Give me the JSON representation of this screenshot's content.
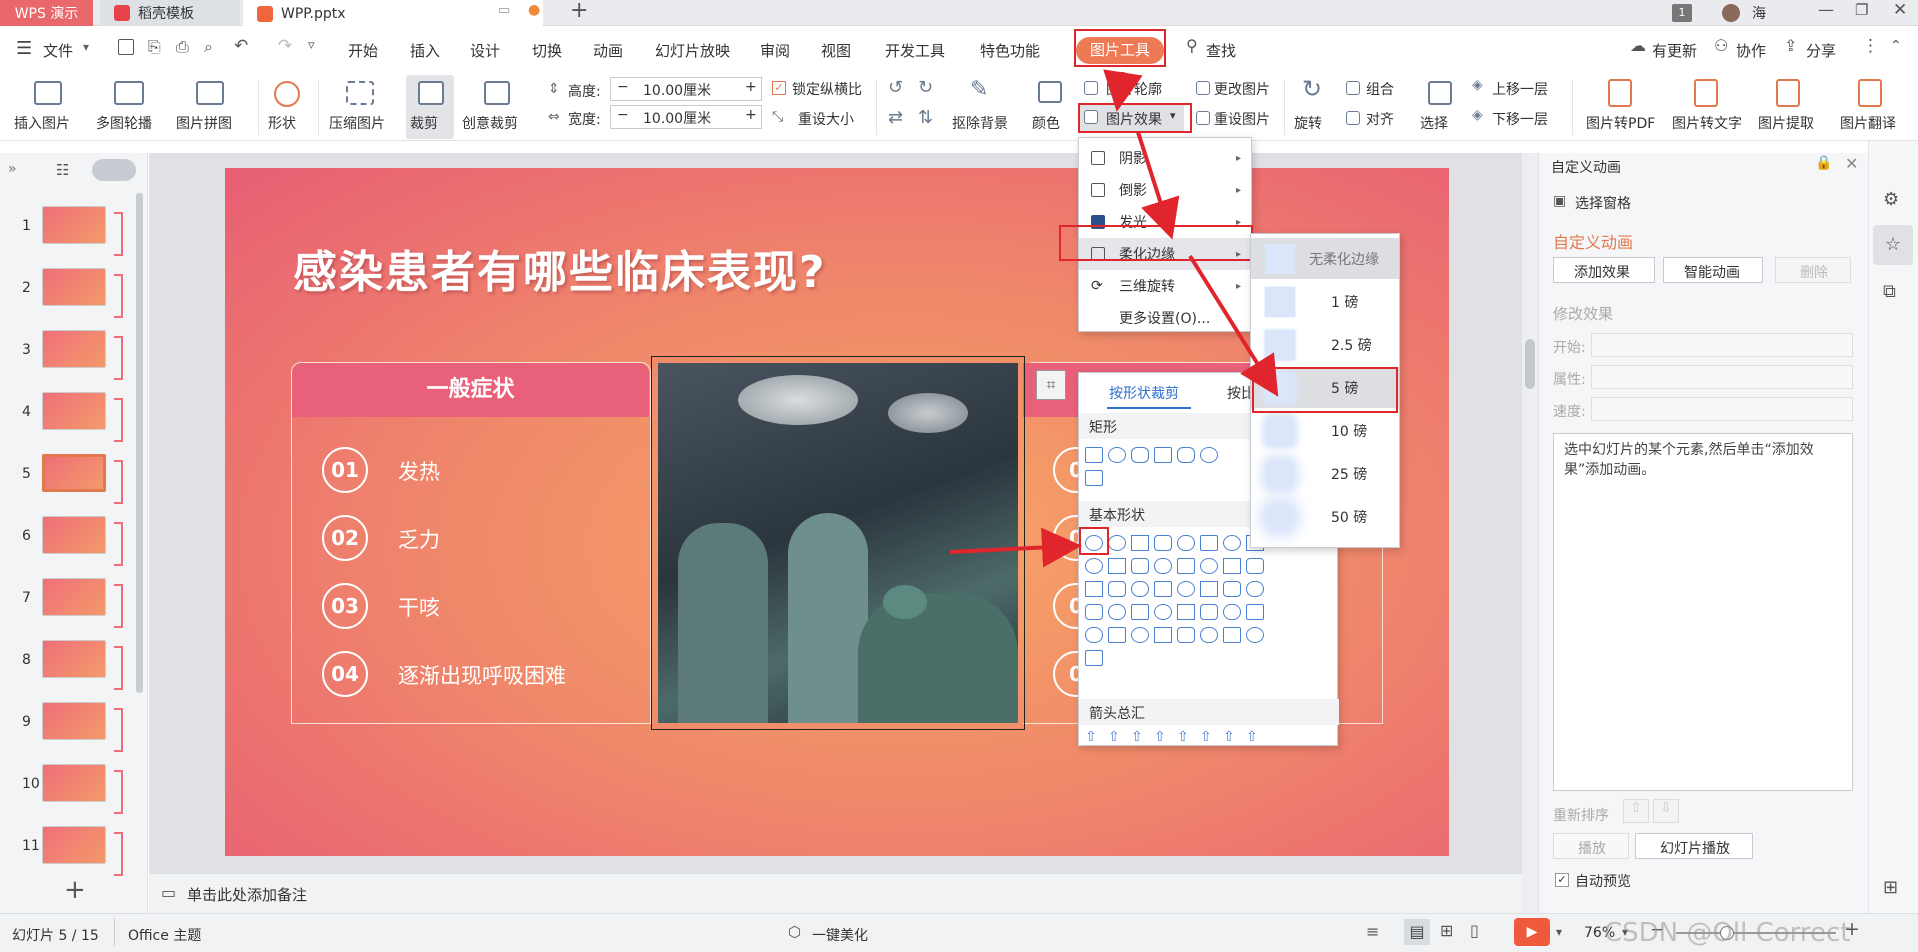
{
  "tabs": {
    "app": "WPS 演示",
    "template": "稻壳模板",
    "doc": "WPP.pptx",
    "page_badge": "1",
    "user": "海"
  },
  "menu": {
    "file": "文件",
    "items": [
      "开始",
      "插入",
      "设计",
      "切换",
      "动画",
      "幻灯片放映",
      "审阅",
      "视图",
      "开发工具",
      "特色功能"
    ],
    "active": "图片工具",
    "search": "查找",
    "update": "有更新",
    "collab": "协作",
    "share": "分享"
  },
  "ribbon": {
    "insert_pic": "插入图片",
    "multi_carousel": "多图轮播",
    "pic_collage": "图片拼图",
    "shape": "形状",
    "compress": "压缩图片",
    "crop": "裁剪",
    "creative_crop": "创意裁剪",
    "height_label": "高度:",
    "height_value": "10.00厘米",
    "width_label": "宽度:",
    "width_value": "10.00厘米",
    "lock_ratio": "锁定纵横比",
    "reset_size": "重设大小",
    "remove_bg": "抠除背景",
    "color": "颜色",
    "outline": "图片轮廓",
    "effects": "图片效果",
    "change_pic": "更改图片",
    "reset_pic": "重设图片",
    "rotate": "旋转",
    "group": "组合",
    "align": "对齐",
    "select": "选择",
    "bring_forward": "上移一层",
    "send_backward": "下移一层",
    "to_pdf": "图片转PDF",
    "to_text": "图片转文字",
    "extract": "图片提取",
    "translate": "图片翻译"
  },
  "slide": {
    "title": "感染患者有哪些临床表现?",
    "left_header": "一般症状",
    "items": [
      {
        "num": "01",
        "text": "发热"
      },
      {
        "num": "02",
        "text": "乏力"
      },
      {
        "num": "03",
        "text": "干咳"
      },
      {
        "num": "04",
        "text": "逐渐出现呼吸困难"
      }
    ],
    "right_nums": [
      "0",
      "0",
      "0",
      "0"
    ]
  },
  "effects_menu": {
    "items": [
      "阴影",
      "倒影",
      "发光",
      "柔化边缘",
      "三维旋转",
      "更多设置(O)..."
    ]
  },
  "soft_edge_menu": {
    "items": [
      "无柔化边缘",
      "1 磅",
      "2.5 磅",
      "5 磅",
      "10 磅",
      "25 磅",
      "50 磅"
    ]
  },
  "crop_panel": {
    "tab1": "按形状裁剪",
    "tab2": "按比",
    "sections": [
      "矩形",
      "基本形状",
      "箭头总汇"
    ]
  },
  "right_panel": {
    "title": "自定义动画",
    "select_pane": "选择窗格",
    "section": "自定义动画",
    "add_effect": "添加效果",
    "smart_anim": "智能动画",
    "delete": "删除",
    "modify": "修改效果",
    "start": "开始:",
    "property": "属性:",
    "speed": "速度:",
    "hint": "选中幻灯片的某个元素,然后单击“添加效果”添加动画。",
    "reorder": "重新排序",
    "play": "播放",
    "slideshow": "幻灯片播放",
    "auto_preview": "自动预览"
  },
  "notes": "单击此处添加备注",
  "status": {
    "slide": "幻灯片 5 / 15",
    "theme": "Office 主题",
    "beautify": "一键美化",
    "zoom": "76%",
    "watermark": "CSDN @Oll Correct"
  },
  "thumb_numbers": [
    "1",
    "2",
    "3",
    "4",
    "5",
    "6",
    "7",
    "8",
    "9",
    "10",
    "11"
  ]
}
